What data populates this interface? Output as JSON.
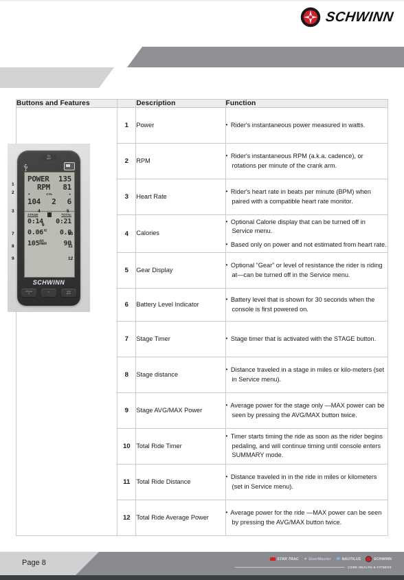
{
  "brand": {
    "name": "SCHWINN",
    "mark": "schwinn-logo-mark"
  },
  "table": {
    "headers": {
      "col1": "Buttons and Features",
      "col2": "",
      "col3": "Description",
      "col4": "Function"
    },
    "rows": [
      {
        "num": "1",
        "description": "Power",
        "function": [
          "Rider's instantaneous power measured in watts."
        ]
      },
      {
        "num": "2",
        "description": "RPM",
        "function": [
          "Rider's instantaneous RPM (a.k.a. cadence), or rotations per minute of the crank arm."
        ]
      },
      {
        "num": "3",
        "description": "Heart Rate",
        "function": [
          "Rider's heart rate in beats per minute (BPM) when paired with a compatible heart rate monitor."
        ]
      },
      {
        "num": "4",
        "description": "Calories",
        "function": [
          "Optional Calorie display that can be turned off in Service menu.",
          "Based only on power and not estimated from heart rate."
        ]
      },
      {
        "num": "5",
        "description": "Gear Display",
        "function": [
          "Optional “Gear” or level of resistance the rider is riding at—can be turned off in the Service menu."
        ]
      },
      {
        "num": "6",
        "description": "Battery Level Indicator",
        "function": [
          "Battery level that is shown for 30 seconds when the console is first powered on."
        ]
      },
      {
        "num": "7",
        "description": "Stage Timer",
        "function": [
          "Stage timer that is activated with the STAGE button."
        ]
      },
      {
        "num": "8",
        "description": "Stage distance",
        "function": [
          "Distance traveled in a stage in miles or kilo-meters (set in Service menu)."
        ]
      },
      {
        "num": "9",
        "description": "Stage AVG/MAX Power",
        "function": [
          "Average power for the stage only —MAX power can be seen by pressing the AVG/MAX button twice."
        ]
      },
      {
        "num": "10",
        "description": "Total Ride Timer",
        "function": [
          "Timer starts timing the ride as soon as the rider begins pedaling, and will continue timing until console enters SUMMARY mode."
        ]
      },
      {
        "num": "11",
        "description": "Total Ride Distance",
        "function": [
          "Distance traveled in in the ride in miles or kilometers (set in Service menu)."
        ]
      },
      {
        "num": "12",
        "description": "Total Ride Average Power",
        "function": [
          "Average power for the ride —MAX power can be seen by pressing the AVG/MAX button twice."
        ]
      }
    ]
  },
  "console_photo": {
    "power_button_label": "ON\nOFF",
    "usb_icon": "usb-icon",
    "battery_icon": "battery-icon",
    "lcd": {
      "power_label": "POWER",
      "power_value": "135",
      "rpm_label": "RPM",
      "rpm_value": "81",
      "heart_icon": "heart-icon",
      "cal_label": "CAL",
      "gear_icon": "gear-dot-icon",
      "heart_rate": "104",
      "calories": "2",
      "gear": "6",
      "stage_label": "STAGE",
      "total_label": "TOTAL",
      "battery_bars": "battery-bars-icon",
      "stage_time": "0:14",
      "total_time": "0:21",
      "stage_distance": "0.06",
      "stage_distance_unit": "MI",
      "total_distance": "0.0",
      "stage_power": "105",
      "avg_power_label": "AVG\nPOWER",
      "total_power": "90"
    },
    "badge": "SCHWINN",
    "buttons": [
      {
        "label": "STAGE\n▭"
      },
      {
        "label": "✦"
      },
      {
        "label": "AVG\nMAX"
      }
    ],
    "callouts": [
      "1",
      "2",
      "3",
      "4",
      "5",
      "6",
      "7",
      "8",
      "9",
      "10",
      "11",
      "12"
    ]
  },
  "footer": {
    "page_label": "Page 8",
    "brands": [
      {
        "name": "STAR TRAC",
        "icon": "star-trac-chip",
        "color": "#d4202a"
      },
      {
        "name": "StairMaster",
        "icon": "stairmaster-mark",
        "color": "#b9a8d4"
      },
      {
        "name": "NAUTILUS",
        "icon": "nautilus-swoosh",
        "color": "#7fb2e5"
      },
      {
        "name": "SCHWINN",
        "icon": "schwinn-ring",
        "color": "#d4202a"
      }
    ],
    "core_text": "CORE HEALTH & FITNESS"
  }
}
